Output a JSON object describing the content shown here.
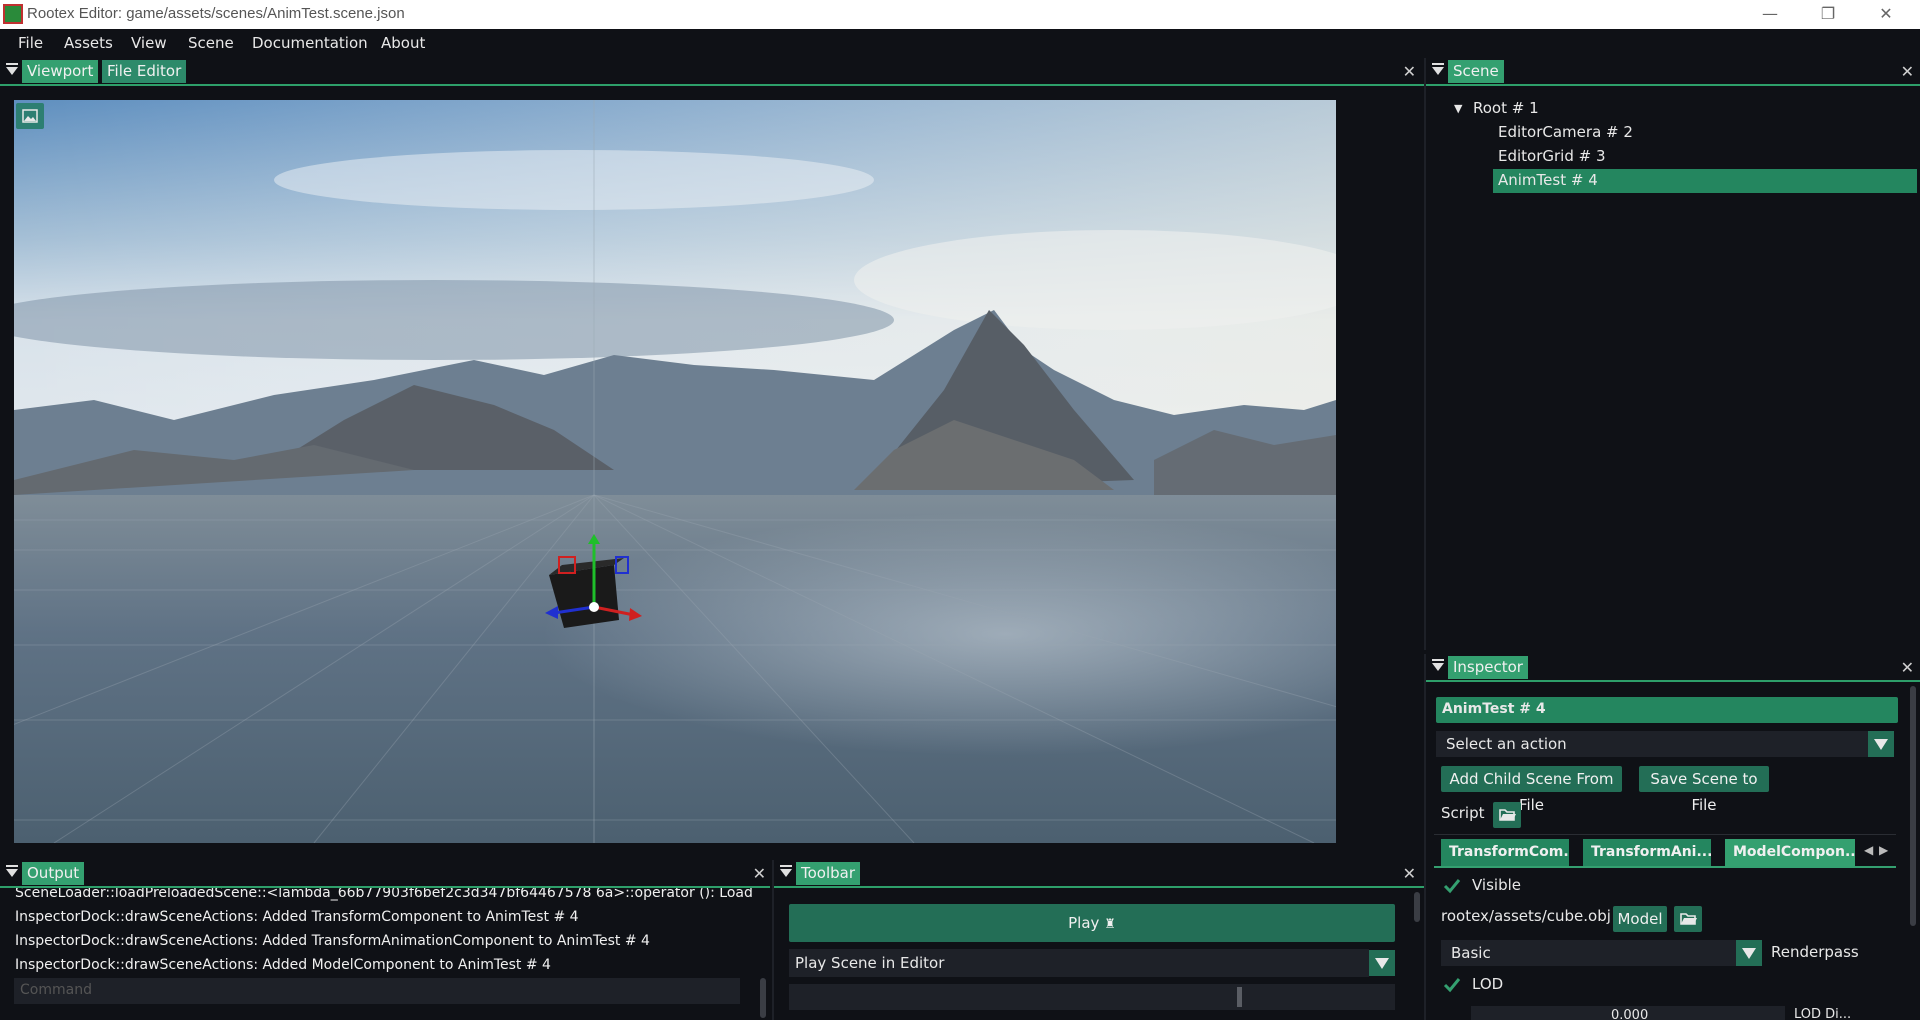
{
  "window": {
    "title": "Rootex Editor: game/assets/scenes/AnimTest.scene.json",
    "controls": [
      "—",
      "❐",
      "✕"
    ]
  },
  "menu": [
    "File",
    "Assets",
    "View",
    "Scene",
    "Documentation",
    "About"
  ],
  "viewport_panel": {
    "tabs": [
      "Viewport",
      "File Editor"
    ],
    "image_button_icon": "image-icon"
  },
  "scene_panel": {
    "tab": "Scene",
    "tree": [
      {
        "label": "Root # 1",
        "expanded": true
      },
      {
        "label": "EditorCamera # 2"
      },
      {
        "label": "EditorGrid # 3"
      },
      {
        "label": "AnimTest # 4",
        "selected": true
      }
    ]
  },
  "inspector": {
    "tab": "Inspector",
    "entity_name": "AnimTest # 4",
    "action_select": "Select an action",
    "add_child_button": "Add Child Scene From File",
    "save_scene_button": "Save Scene to File",
    "script_label": "Script",
    "component_tabs": [
      "TransformCom...",
      "TransformAni...",
      "ModelCompon..."
    ],
    "visible_label": "Visible",
    "model_path": "rootex/assets/cube.obj",
    "model_button": "Model",
    "renderpass_value": "Basic",
    "renderpass_label": "Renderpass",
    "lod_label": "LOD",
    "partial_value": "0.000",
    "partial_label": "LOD Di..."
  },
  "output_panel": {
    "tab": "Output",
    "lines": [
      "SceneLoader::loadPreloadedScene::<lambda_66b77903f6bef2c3d347bf64467578 6a>::operator (): Loaded scer",
      "InspectorDock::drawSceneActions: Added TransformComponent to AnimTest # 4",
      "InspectorDock::drawSceneActions: Added TransformAnimationComponent to AnimTest # 4",
      "InspectorDock::drawSceneActions: Added ModelComponent to AnimTest # 4"
    ],
    "command_placeholder": "Command"
  },
  "toolbar_panel": {
    "tab": "Toolbar",
    "play_button": "Play",
    "play_mode": "Play Scene in Editor"
  },
  "colors": {
    "accent": "#2e9f6a",
    "tab": "#2d8a6a",
    "button": "#236e56",
    "background": "#0f1116"
  }
}
